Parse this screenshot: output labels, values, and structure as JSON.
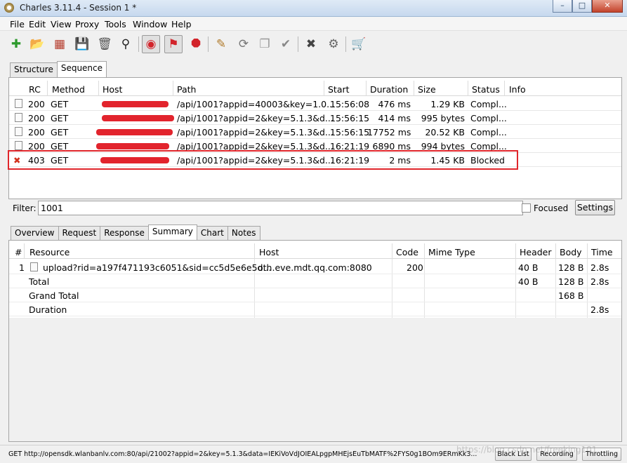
{
  "window": {
    "title": "Charles 3.11.4 - Session 1 *"
  },
  "menu": [
    "File",
    "Edit",
    "View",
    "Proxy",
    "Tools",
    "Window",
    "Help"
  ],
  "top_tabs": [
    "Structure",
    "Sequence"
  ],
  "sequence": {
    "headers": [
      "RC",
      "Method",
      "Host",
      "Path",
      "Start",
      "Duration",
      "Size",
      "Status",
      "Info"
    ],
    "rows": [
      {
        "rc": "200",
        "method": "GET",
        "host": "...",
        "path": "/api/1001?appid=40003&key=1.0...",
        "start": "15:56:08",
        "duration": "476 ms",
        "size": "1.29 KB",
        "status": "Compl..."
      },
      {
        "rc": "200",
        "method": "GET",
        "host": "...",
        "path": "/api/1001?appid=2&key=5.1.3&d...",
        "start": "15:56:15",
        "duration": "414 ms",
        "size": "995 bytes",
        "status": "Compl..."
      },
      {
        "rc": "200",
        "method": "GET",
        "host": "...",
        "path": "/api/1001?appid=2&key=5.1.3&d...",
        "start": "15:56:15",
        "duration": "17752 ms",
        "size": "20.52 KB",
        "status": "Compl..."
      },
      {
        "rc": "200",
        "method": "GET",
        "host": "...",
        "path": "/api/1001?appid=2&key=5.1.3&d...",
        "start": "16:21:19",
        "duration": "6890 ms",
        "size": "994 bytes",
        "status": "Compl..."
      },
      {
        "rc": "403",
        "method": "GET",
        "host": "...",
        "path": "/api/1001?appid=2&key=5.1.3&d...",
        "start": "16:21:19",
        "duration": "2 ms",
        "size": "1.45 KB",
        "status": "Blocked"
      }
    ]
  },
  "filter": {
    "label": "Filter:",
    "value": "1001",
    "focused_label": "Focused",
    "settings_label": "Settings"
  },
  "detail_tabs": [
    "Overview",
    "Request",
    "Response",
    "Summary",
    "Chart",
    "Notes"
  ],
  "summary": {
    "headers": [
      "#",
      "Resource",
      "Host",
      "Code",
      "Mime Type",
      "Header",
      "Body",
      "Time"
    ],
    "rows": [
      {
        "num": "1",
        "resource": "upload?rid=a197f471193c6051&sid=cc5d5e6e5d...",
        "host": "oth.eve.mdt.qq.com:8080",
        "code": "200",
        "mime": "",
        "header": "40 B",
        "body": "128 B",
        "time": "2.8s"
      },
      {
        "num": "",
        "resource": "Total",
        "host": "",
        "code": "",
        "mime": "",
        "header": "40 B",
        "body": "128 B",
        "time": "2.8s"
      },
      {
        "num": "",
        "resource": "Grand Total",
        "host": "",
        "code": "",
        "mime": "",
        "header": "",
        "body": "168 B",
        "time": ""
      },
      {
        "num": "",
        "resource": "Duration",
        "host": "",
        "code": "",
        "mime": "",
        "header": "",
        "body": "",
        "time": "2.8s"
      }
    ]
  },
  "status_bar": {
    "message": "GET http://opensdk.wlanbanlv.com:80/api/21002?appid=2&key=5.1.3&data=IEKiVoVdJOIEALpgpMHEjsEuTbMATF%2FYS0g1BOm9ERmKk3...",
    "buttons": [
      "Black List",
      "Recording",
      "Throttling"
    ],
    "watermark": "https://blog.csdn.net/freeking101"
  },
  "colors": {
    "highlight_border": "#e0262b",
    "redaction": "#e2242d"
  }
}
